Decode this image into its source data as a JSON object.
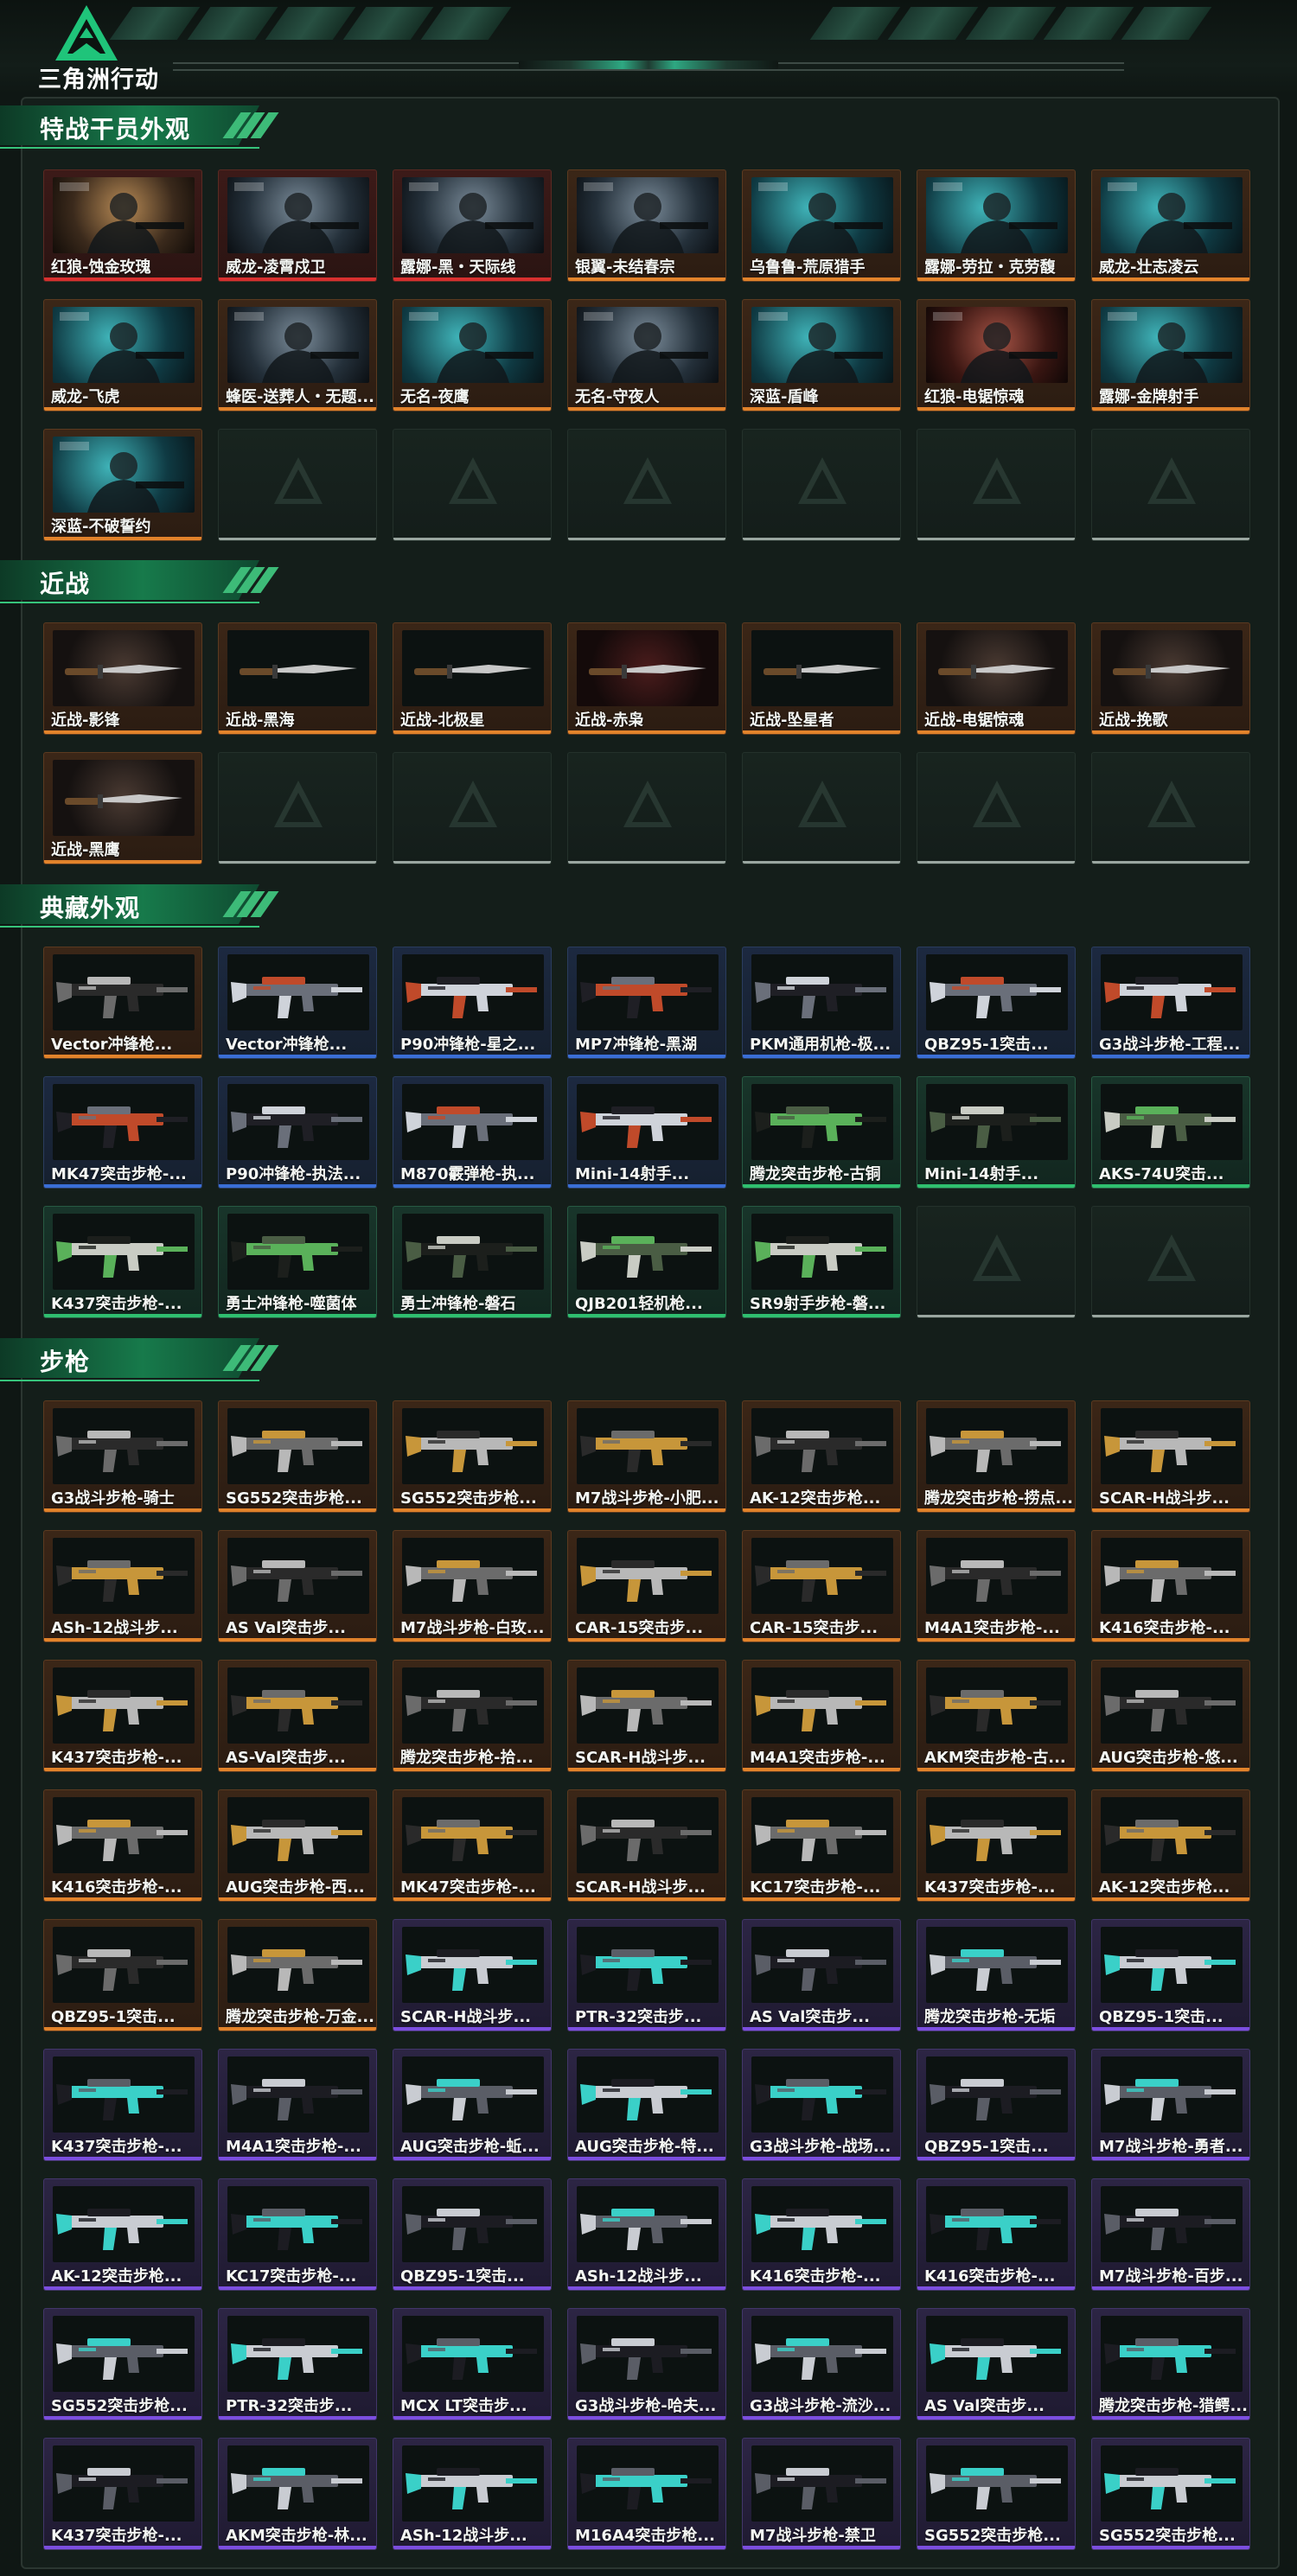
{
  "app": {
    "logo_text": "三角洲行动"
  },
  "colors": {
    "accent": "#2fbf6f",
    "rarity_red": "#d8302f",
    "rarity_orange": "#e2832b",
    "rarity_blue": "#3a6ed6",
    "rarity_green": "#2fbf6f",
    "rarity_purple": "#7c4ee0"
  },
  "sections": [
    {
      "title": "特战干员外观"
    },
    {
      "title": "近战"
    },
    {
      "title": "典藏外观"
    },
    {
      "title": "步枪"
    }
  ],
  "operators": [
    {
      "label": "红狼-蚀金玫瑰",
      "rarity": "red"
    },
    {
      "label": "威龙-凌霄戍卫",
      "rarity": "red"
    },
    {
      "label": "露娜-黑・天际线",
      "rarity": "red"
    },
    {
      "label": "银翼-未结春宗",
      "rarity": "orange"
    },
    {
      "label": "乌鲁鲁-荒原猎手",
      "rarity": "orange"
    },
    {
      "label": "露娜-劳拉・克劳馥",
      "rarity": "orange"
    },
    {
      "label": "威龙-壮志凌云",
      "rarity": "orange"
    },
    {
      "label": "威龙-飞虎",
      "rarity": "orange"
    },
    {
      "label": "蜂医-送葬人・无题...",
      "rarity": "orange"
    },
    {
      "label": "无名-夜鹰",
      "rarity": "orange"
    },
    {
      "label": "无名-守夜人",
      "rarity": "orange"
    },
    {
      "label": "深蓝-盾峰",
      "rarity": "orange"
    },
    {
      "label": "红狼-电锯惊魂",
      "rarity": "orange"
    },
    {
      "label": "露娜-金牌射手",
      "rarity": "orange"
    },
    {
      "label": "深蓝-不破誓约",
      "rarity": "orange"
    }
  ],
  "melee": [
    {
      "label": "近战-影锋",
      "rarity": "orange"
    },
    {
      "label": "近战-黑海",
      "rarity": "orange"
    },
    {
      "label": "近战-北极星",
      "rarity": "orange"
    },
    {
      "label": "近战-赤枭",
      "rarity": "orange"
    },
    {
      "label": "近战-坠星者",
      "rarity": "orange"
    },
    {
      "label": "近战-电锯惊魂",
      "rarity": "orange"
    },
    {
      "label": "近战-挽歌",
      "rarity": "orange"
    },
    {
      "label": "近战-黑鹰",
      "rarity": "orange"
    }
  ],
  "collection": [
    {
      "label": "Vector冲锋枪...",
      "rarity": "orange"
    },
    {
      "label": "Vector冲锋枪...",
      "rarity": "blue"
    },
    {
      "label": "P90冲锋枪-星之...",
      "rarity": "blue"
    },
    {
      "label": "MP7冲锋枪-黑湖",
      "rarity": "blue"
    },
    {
      "label": "PKM通用机枪-极...",
      "rarity": "blue"
    },
    {
      "label": "QBZ95-1突击...",
      "rarity": "blue"
    },
    {
      "label": "G3战斗步枪-工程...",
      "rarity": "blue"
    },
    {
      "label": "MK47突击步枪-...",
      "rarity": "blue"
    },
    {
      "label": "P90冲锋枪-执法...",
      "rarity": "blue"
    },
    {
      "label": "M870霰弹枪-执...",
      "rarity": "blue"
    },
    {
      "label": "Mini-14射手...",
      "rarity": "blue"
    },
    {
      "label": "腾龙突击步枪-古铜",
      "rarity": "green"
    },
    {
      "label": "Mini-14射手...",
      "rarity": "green"
    },
    {
      "label": "AKS-74U突击...",
      "rarity": "green"
    },
    {
      "label": "K437突击步枪-...",
      "rarity": "green"
    },
    {
      "label": "勇士冲锋枪-噬菌体",
      "rarity": "green"
    },
    {
      "label": "勇士冲锋枪-磐石",
      "rarity": "green"
    },
    {
      "label": "QJB201轻机枪...",
      "rarity": "green"
    },
    {
      "label": "SR9射手步枪-磐...",
      "rarity": "green"
    }
  ],
  "rifles": [
    {
      "label": "G3战斗步枪-骑士",
      "rarity": "orange"
    },
    {
      "label": "SG552突击步枪...",
      "rarity": "orange"
    },
    {
      "label": "SG552突击步枪...",
      "rarity": "orange"
    },
    {
      "label": "M7战斗步枪-小肥...",
      "rarity": "orange"
    },
    {
      "label": "AK-12突击步枪...",
      "rarity": "orange"
    },
    {
      "label": "腾龙突击步枪-捞点...",
      "rarity": "orange"
    },
    {
      "label": "SCAR-H战斗步...",
      "rarity": "orange"
    },
    {
      "label": "ASh-12战斗步...",
      "rarity": "orange"
    },
    {
      "label": "AS Val突击步...",
      "rarity": "orange"
    },
    {
      "label": "M7战斗步枪-白玫...",
      "rarity": "orange"
    },
    {
      "label": "CAR-15突击步...",
      "rarity": "orange"
    },
    {
      "label": "CAR-15突击步...",
      "rarity": "orange"
    },
    {
      "label": "M4A1突击步枪-...",
      "rarity": "orange"
    },
    {
      "label": "K416突击步枪-...",
      "rarity": "orange"
    },
    {
      "label": "K437突击步枪-...",
      "rarity": "orange"
    },
    {
      "label": "AS-Val突击步...",
      "rarity": "orange"
    },
    {
      "label": "腾龙突击步枪-拾...",
      "rarity": "orange"
    },
    {
      "label": "SCAR-H战斗步...",
      "rarity": "orange"
    },
    {
      "label": "M4A1突击步枪-...",
      "rarity": "orange"
    },
    {
      "label": "AKM突击步枪-古...",
      "rarity": "orange"
    },
    {
      "label": "AUG突击步枪-悠...",
      "rarity": "orange"
    },
    {
      "label": "K416突击步枪-...",
      "rarity": "orange"
    },
    {
      "label": "AUG突击步枪-西...",
      "rarity": "orange"
    },
    {
      "label": "MK47突击步枪-...",
      "rarity": "orange"
    },
    {
      "label": "SCAR-H战斗步...",
      "rarity": "orange"
    },
    {
      "label": "KC17突击步枪-...",
      "rarity": "orange"
    },
    {
      "label": "K437突击步枪-...",
      "rarity": "orange"
    },
    {
      "label": "AK-12突击步枪...",
      "rarity": "orange"
    },
    {
      "label": "QBZ95-1突击...",
      "rarity": "orange"
    },
    {
      "label": "腾龙突击步枪-万金...",
      "rarity": "orange"
    },
    {
      "label": "SCAR-H战斗步...",
      "rarity": "purple"
    },
    {
      "label": "PTR-32突击步...",
      "rarity": "purple"
    },
    {
      "label": "AS Val突击步...",
      "rarity": "purple"
    },
    {
      "label": "腾龙突击步枪-无垢",
      "rarity": "purple"
    },
    {
      "label": "QBZ95-1突击...",
      "rarity": "purple"
    },
    {
      "label": "K437突击步枪-...",
      "rarity": "purple"
    },
    {
      "label": "M4A1突击步枪-...",
      "rarity": "purple"
    },
    {
      "label": "AUG突击步枪-蚯...",
      "rarity": "purple"
    },
    {
      "label": "AUG突击步枪-特...",
      "rarity": "purple"
    },
    {
      "label": "G3战斗步枪-战场...",
      "rarity": "purple"
    },
    {
      "label": "QBZ95-1突击...",
      "rarity": "purple"
    },
    {
      "label": "M7战斗步枪-勇者...",
      "rarity": "purple"
    },
    {
      "label": "AK-12突击步枪...",
      "rarity": "purple"
    },
    {
      "label": "KC17突击步枪-...",
      "rarity": "purple"
    },
    {
      "label": "QBZ95-1突击...",
      "rarity": "purple"
    },
    {
      "label": "ASh-12战斗步...",
      "rarity": "purple"
    },
    {
      "label": "K416突击步枪-...",
      "rarity": "purple"
    },
    {
      "label": "K416突击步枪-...",
      "rarity": "purple"
    },
    {
      "label": "M7战斗步枪-百步...",
      "rarity": "purple"
    },
    {
      "label": "SG552突击步枪...",
      "rarity": "purple"
    },
    {
      "label": "PTR-32突击步...",
      "rarity": "purple"
    },
    {
      "label": "MCX LT突击步...",
      "rarity": "purple"
    },
    {
      "label": "G3战斗步枪-哈夫...",
      "rarity": "purple"
    },
    {
      "label": "G3战斗步枪-流沙...",
      "rarity": "purple"
    },
    {
      "label": "AS Val突击步...",
      "rarity": "purple"
    },
    {
      "label": "腾龙突击步枪-猎鳄...",
      "rarity": "purple"
    },
    {
      "label": "K437突击步枪-...",
      "rarity": "purple"
    },
    {
      "label": "AKM突击步枪-林...",
      "rarity": "purple"
    },
    {
      "label": "ASh-12战斗步...",
      "rarity": "purple"
    },
    {
      "label": "M16A4突击步枪...",
      "rarity": "purple"
    },
    {
      "label": "M7战斗步枪-禁卫",
      "rarity": "purple"
    },
    {
      "label": "SG552突击步枪...",
      "rarity": "purple"
    },
    {
      "label": "SG552突击步枪...",
      "rarity": "purple"
    }
  ]
}
